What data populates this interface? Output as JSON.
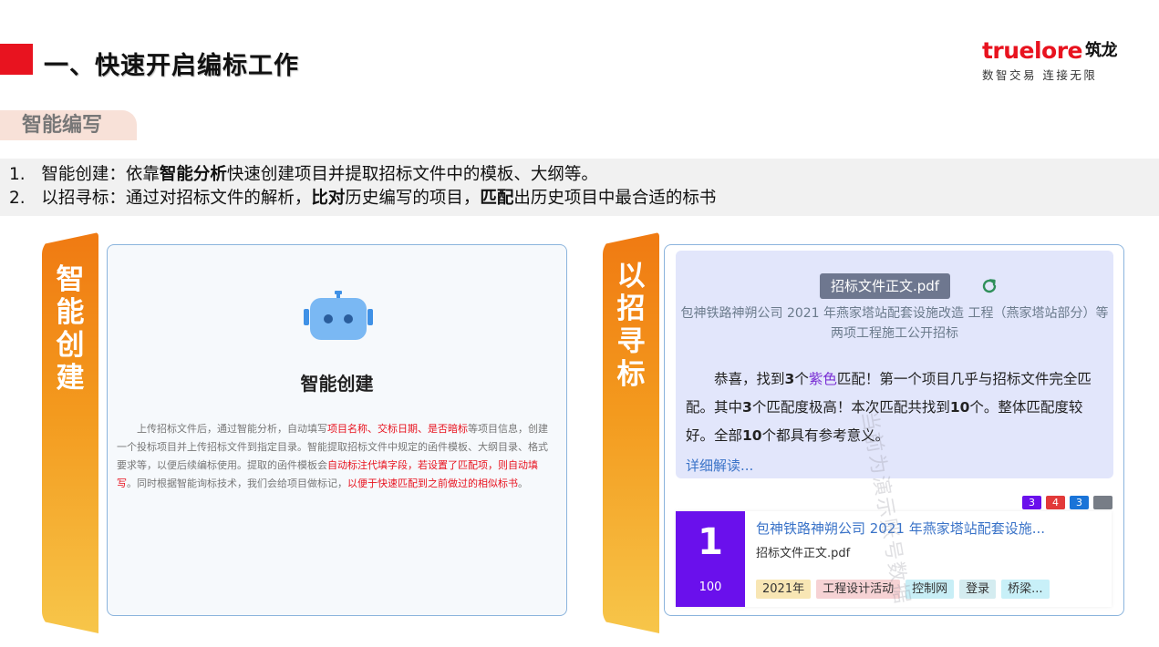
{
  "header": {
    "title": "一、快速开启编标工作",
    "logo_main": "truelore",
    "logo_cn": "筑龙",
    "logo_sub": "数智交易 连接无限"
  },
  "section_tag": "智能编写",
  "intro": {
    "line1": {
      "num": "1.",
      "pre": "智能创建：依靠",
      "b1": "智能分析",
      "post": "快速创建项目并提取招标文件中的模板、大纲等。"
    },
    "line2": {
      "num": "2.",
      "pre": "以招寻标：通过对招标文件的解析，",
      "b1": "比对",
      "mid": "历史编写的项目，",
      "b2": "匹配",
      "post": "出历史项目中最合适的标书"
    }
  },
  "left_banner": [
    "智",
    "能",
    "创",
    "建"
  ],
  "right_banner": [
    "以",
    "招",
    "寻",
    "标"
  ],
  "left_card": {
    "title": "智能创建",
    "body": [
      {
        "t": "上传招标文件后，通过智能分析，自动填写",
        "red": false
      },
      {
        "t": "项目名称、交标日期、是否暗标",
        "red": true
      },
      {
        "t": "等项目信息，创建一个投标项目并上传招标文件到指定目录。智能提取招标文件中规定的函件模板、大纲目录、格式要求等，以便后续编标使用。提取的函件模板会",
        "red": false
      },
      {
        "t": "自动标注代填字段，若设置了匹配项，则自动填写",
        "red": true
      },
      {
        "t": "。同时根据智能询标技术，我们会给项目做标记，",
        "red": false
      },
      {
        "t": "以便于快速匹配到之前做过的相似标书",
        "red": true
      },
      {
        "t": "。",
        "red": false
      }
    ]
  },
  "right_card": {
    "file_chip": "招标文件正文.pdf",
    "project_name": "包神铁路神朔公司 2021 年燕家塔站配套设施改造 工程（燕家塔站部分）等两项工程施工公开招标",
    "match": {
      "s1": "恭喜，找到",
      "b1": "3",
      "s2": "个",
      "purple": "紫色",
      "s3": "匹配！第一个项目几乎与招标文件完全匹配。其中",
      "b2": "3",
      "s4": "个匹配度极高！本次匹配共找到",
      "b3": "10",
      "s5": "个。整体匹配度较好。全部",
      "b4": "10",
      "s6": "个都具有参考意义。"
    },
    "detail_link": "详细解读...",
    "counts": [
      {
        "v": "3",
        "color": "#6a10ec"
      },
      {
        "v": "4",
        "color": "#e23a3a"
      },
      {
        "v": "3",
        "color": "#1a74d8"
      },
      {
        "v": "",
        "color": "#777d86"
      }
    ],
    "result": {
      "rank": "1",
      "score": "100",
      "title": "包神铁路神朔公司 2021 年燕家塔站配套设施...",
      "file": "招标文件正文.pdf",
      "tags": [
        {
          "label": "2021年",
          "bg": "#f8e6b4"
        },
        {
          "label": "工程设计活动",
          "bg": "#f6d2d4"
        },
        {
          "label": "控制网",
          "bg": "#c8eef6"
        },
        {
          "label": "登录",
          "bg": "#d4ecf0"
        },
        {
          "label": "桥梁...",
          "bg": "#c8f0f8"
        }
      ]
    }
  },
  "watermark": "当前为演示账号数据"
}
